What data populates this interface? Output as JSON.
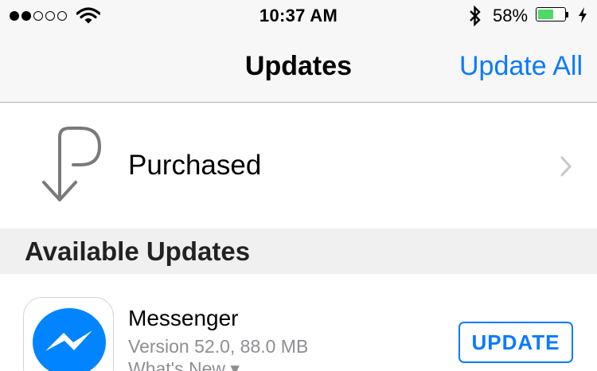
{
  "status_bar": {
    "signal_bars_filled": 2,
    "signal_bars_total": 5,
    "time": "10:37 AM",
    "battery_percent_label": "58%",
    "battery_level": 0.58,
    "icons": [
      "signal-dots",
      "wifi-icon",
      "bluetooth-icon",
      "battery-icon",
      "charging-bolt-icon"
    ]
  },
  "nav": {
    "title": "Updates",
    "action_label": "Update All",
    "action_color": "#0a7aff"
  },
  "purchased": {
    "label": "Purchased",
    "icon": "purchased-arrow-icon"
  },
  "section": {
    "title": "Available Updates"
  },
  "updates": [
    {
      "name": "Messenger",
      "version": "Version 52.0, 88.0 MB",
      "whats_new": "What's New ▾",
      "button_label": "UPDATE",
      "icon": "messenger-icon",
      "icon_color": "#0084ff"
    }
  ],
  "colors": {
    "accent": "#0a7aff",
    "battery_fill": "#4cd964",
    "secondary_text": "#8e8e93"
  }
}
